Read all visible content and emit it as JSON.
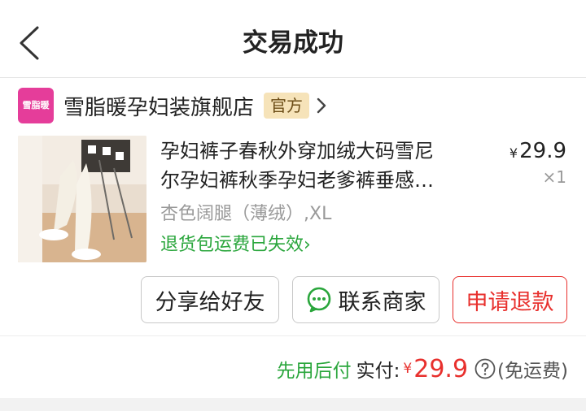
{
  "header": {
    "title": "交易成功",
    "back_icon": "chevron-left-icon"
  },
  "store": {
    "logo_text": "雪脂暖",
    "logo_color": "#e53d9a",
    "name": "雪脂暖孕妇装旗舰店",
    "badge": "官方",
    "chevron_icon": "chevron-right-icon"
  },
  "product": {
    "title_line1": "孕妇裤子春秋外穿加绒大码雪尼",
    "title_line2": "尔孕妇裤秋季孕妇老爹裤垂感…",
    "price_symbol": "¥",
    "price": "29.9",
    "quantity": "×1",
    "spec": "杏色阔腿（薄绒）,XL",
    "return_note": "退货包运费已失效",
    "return_note_chevron": "›"
  },
  "actions": {
    "share": "分享给好友",
    "contact": "联系商家",
    "refund": "申请退款"
  },
  "payment": {
    "pay_later": "先用后付",
    "paid_label": "实付:",
    "currency": "¥",
    "amount": "29.9",
    "help_icon": "question-circle-icon",
    "shipping": "(免运费)"
  },
  "colors": {
    "accent_red": "#e8302d",
    "accent_green": "#2aa63c",
    "badge_bg": "#f6e3b9"
  }
}
